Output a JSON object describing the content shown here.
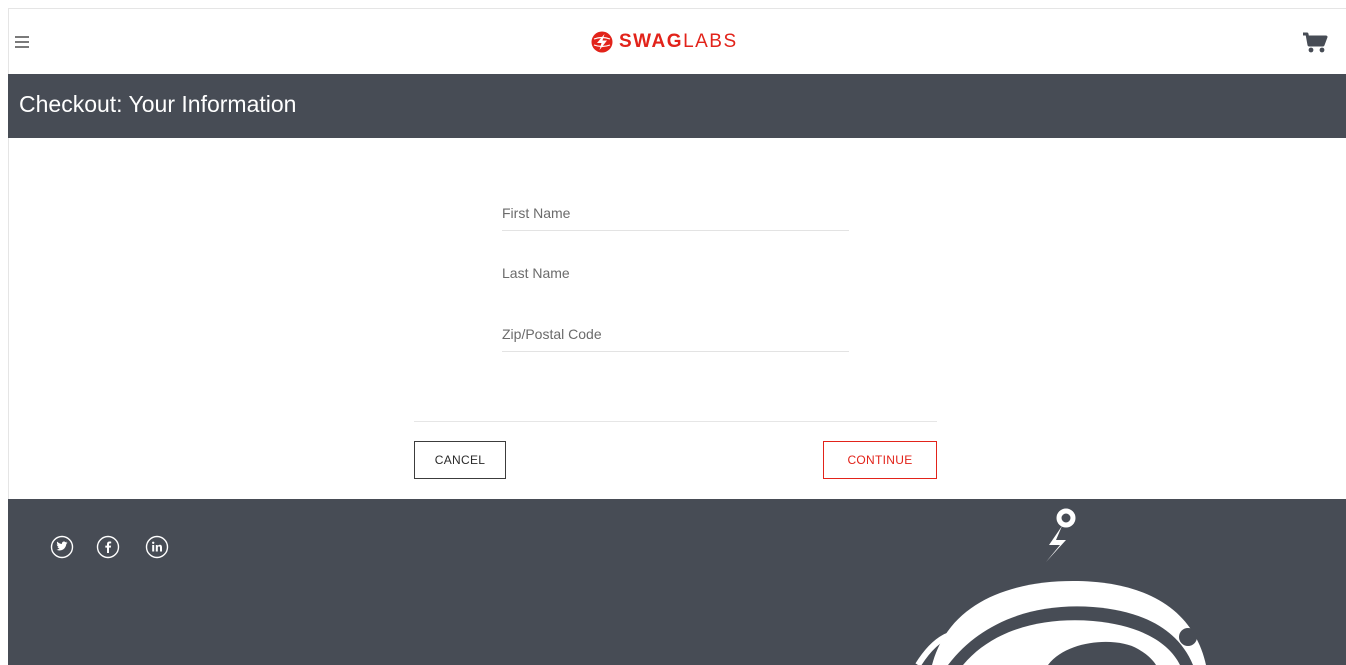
{
  "header": {
    "logo_swag": "SWAG",
    "logo_labs": "LABS",
    "brand_color": "#e2231a",
    "menu_icon": "hamburger-menu-icon",
    "cart_icon": "shopping-cart-icon"
  },
  "subheader": {
    "title": "Checkout: Your Information",
    "bg_color": "#474c55"
  },
  "form": {
    "first_name": {
      "placeholder": "First Name",
      "value": ""
    },
    "last_name": {
      "placeholder": "Last Name",
      "value": ""
    },
    "postal_code": {
      "placeholder": "Zip/Postal Code",
      "value": ""
    },
    "cancel_label": "CANCEL",
    "continue_label": "CONTINUE"
  },
  "footer": {
    "social": [
      "twitter-icon",
      "facebook-icon",
      "linkedin-icon"
    ],
    "mascot": "swag-bot-mascot"
  }
}
